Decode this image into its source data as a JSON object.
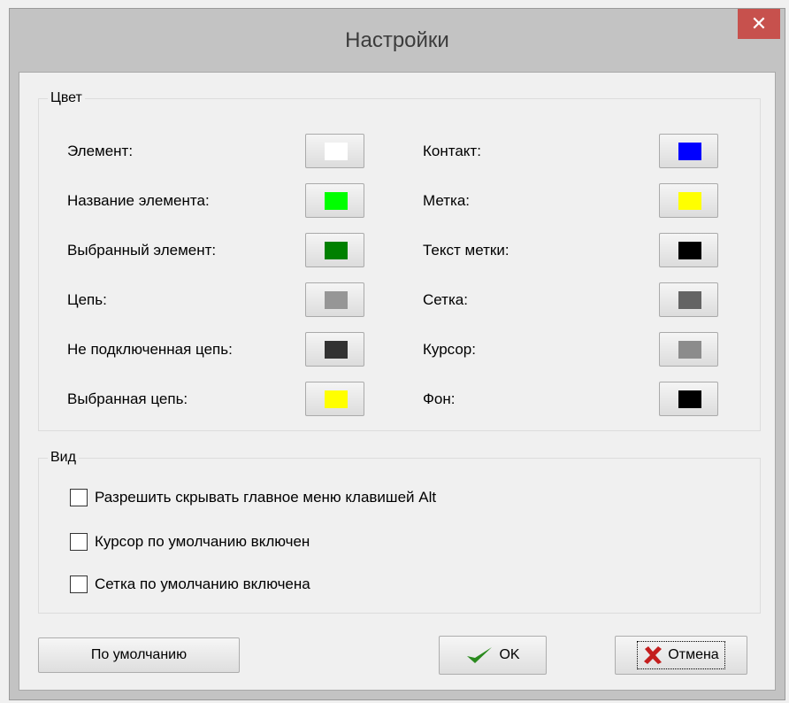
{
  "window": {
    "title": "Настройки"
  },
  "colors_group": {
    "title": "Цвет",
    "left": [
      {
        "label": "Элемент:",
        "color": "#ffffff"
      },
      {
        "label": "Название элемента:",
        "color": "#00ff00"
      },
      {
        "label": "Выбранный элемент:",
        "color": "#008000"
      },
      {
        "label": "Цепь:",
        "color": "#969696"
      },
      {
        "label": "Не подключенная цепь:",
        "color": "#323232"
      },
      {
        "label": "Выбранная цепь:",
        "color": "#ffff00"
      }
    ],
    "right": [
      {
        "label": "Контакт:",
        "color": "#0000ff"
      },
      {
        "label": "Метка:",
        "color": "#ffff00"
      },
      {
        "label": "Текст метки:",
        "color": "#000000"
      },
      {
        "label": "Сетка:",
        "color": "#646464"
      },
      {
        "label": "Курсор:",
        "color": "#8c8c8c"
      },
      {
        "label": "Фон:",
        "color": "#000000"
      }
    ]
  },
  "view_group": {
    "title": "Вид",
    "options": [
      {
        "label": "Разрешить скрывать главное меню клавишей Alt",
        "checked": false
      },
      {
        "label": "Курсор по умолчанию включен",
        "checked": false
      },
      {
        "label": "Сетка по умолчанию включена",
        "checked": false
      }
    ]
  },
  "buttons": {
    "default_label": "По умолчанию",
    "ok_label": "OK",
    "cancel_label": "Отмена",
    "ok_icon": "checkmark-icon",
    "cancel_icon": "cross-icon",
    "ok_icon_color": "#2a8a1e",
    "cancel_icon_color": "#c41e1e"
  }
}
